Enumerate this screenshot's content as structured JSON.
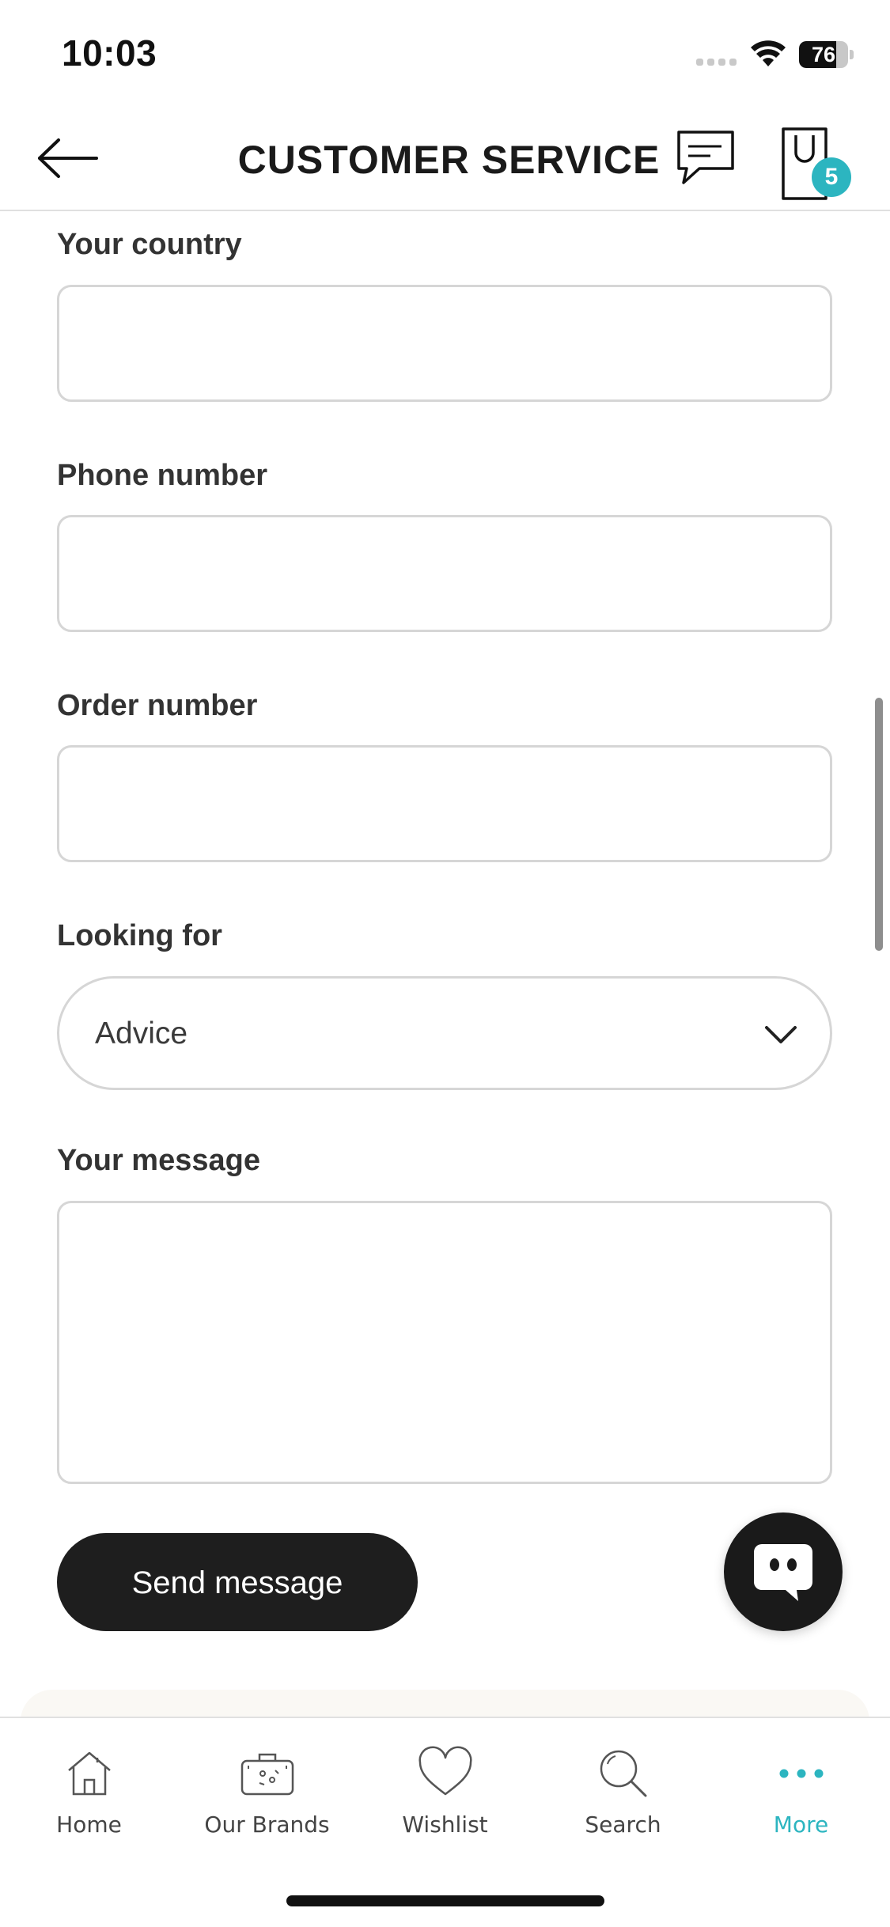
{
  "status_bar": {
    "time": "10:03",
    "battery_level": "76",
    "battery_fraction": 0.76
  },
  "header": {
    "title": "CUSTOMER SERVICE",
    "cart_count": "5"
  },
  "form": {
    "country_label": "Your country",
    "country_value": "",
    "phone_label": "Phone number",
    "phone_value": "",
    "order_label": "Order number",
    "order_value": "",
    "looking_for_label": "Looking for",
    "looking_for_value": "Advice",
    "message_label": "Your message",
    "message_value": "",
    "send_label": "Send message"
  },
  "bottom_nav": {
    "items": [
      {
        "label": "Home",
        "icon": "home-icon"
      },
      {
        "label": "Our Brands",
        "icon": "suitcase-icon"
      },
      {
        "label": "Wishlist",
        "icon": "heart-icon"
      },
      {
        "label": "Search",
        "icon": "search-icon"
      },
      {
        "label": "More",
        "icon": "more-icon",
        "active": true
      }
    ]
  },
  "colors": {
    "accent": "#2cb5c0",
    "button_dark": "#1e1e1e",
    "border": "#d6d6d6"
  }
}
